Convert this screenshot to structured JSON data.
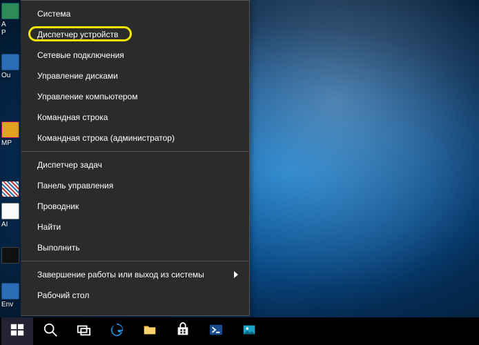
{
  "desktop_icons": [
    {
      "label_fragment": "A",
      "variant": "green"
    },
    {
      "label_fragment": "P",
      "variant": "white"
    },
    {
      "label_fragment": "Ou",
      "variant": "blue"
    },
    {
      "label_fragment": "МР",
      "variant": "yellow"
    },
    {
      "label_fragment": "",
      "variant": "stripe"
    },
    {
      "label_fragment": "AI",
      "variant": "white"
    },
    {
      "label_fragment": "",
      "variant": "dark"
    },
    {
      "label_fragment": "Env",
      "variant": "blue"
    }
  ],
  "winx": {
    "groups": [
      [
        "Система",
        "Диспетчер устройств",
        "Сетевые подключения",
        "Управление дисками",
        "Управление компьютером",
        "Командная строка",
        "Командная строка (администратор)"
      ],
      [
        "Диспетчер задач",
        "Панель управления",
        "Проводник",
        "Найти",
        "Выполнить"
      ],
      [
        {
          "label": "Завершение работы или выход из системы",
          "submenu": true
        },
        "Рабочий стол"
      ]
    ],
    "highlighted_index": 1
  },
  "taskbar": {
    "items": [
      {
        "name": "start",
        "icon": "windows-icon"
      },
      {
        "name": "search",
        "icon": "search-icon"
      },
      {
        "name": "taskview",
        "icon": "taskview-icon"
      },
      {
        "name": "edge",
        "icon": "edge-icon"
      },
      {
        "name": "explorer",
        "icon": "folder-icon"
      },
      {
        "name": "store",
        "icon": "store-icon"
      },
      {
        "name": "powershell",
        "icon": "powershell-icon"
      },
      {
        "name": "photos",
        "icon": "photos-icon"
      }
    ]
  }
}
